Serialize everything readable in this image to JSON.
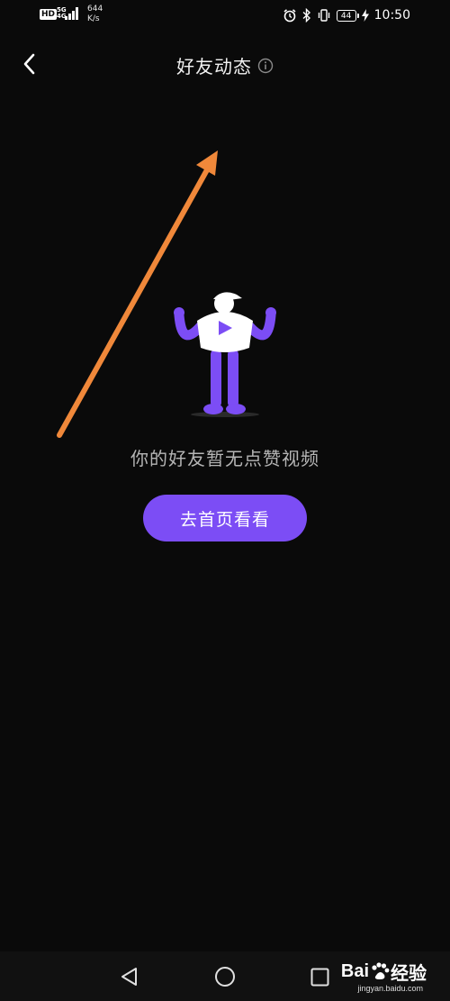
{
  "status_bar": {
    "hd_badge": "HD",
    "network_label": "5G",
    "network_sub": "4G",
    "speed_value": "644",
    "speed_unit": "K/s",
    "battery": "44",
    "time": "10:50"
  },
  "header": {
    "title": "好友动态",
    "back_icon": "chevron-left-icon",
    "info_icon": "info-circle-icon"
  },
  "empty_state": {
    "message": "你的好友暂无点赞视频",
    "button_label": "去首页看看"
  },
  "nav_bar": {
    "back_icon": "triangle-back-icon",
    "home_icon": "circle-home-icon",
    "recent_icon": "square-recent-icon"
  },
  "watermark": {
    "brand": "Bai",
    "brand_tail": "经验",
    "url": "jingyan.baidu.com"
  },
  "colors": {
    "background": "#0a0a0a",
    "accent": "#7c4df5",
    "annotation_arrow": "#f0883a",
    "message_text": "#b5b5b5"
  }
}
